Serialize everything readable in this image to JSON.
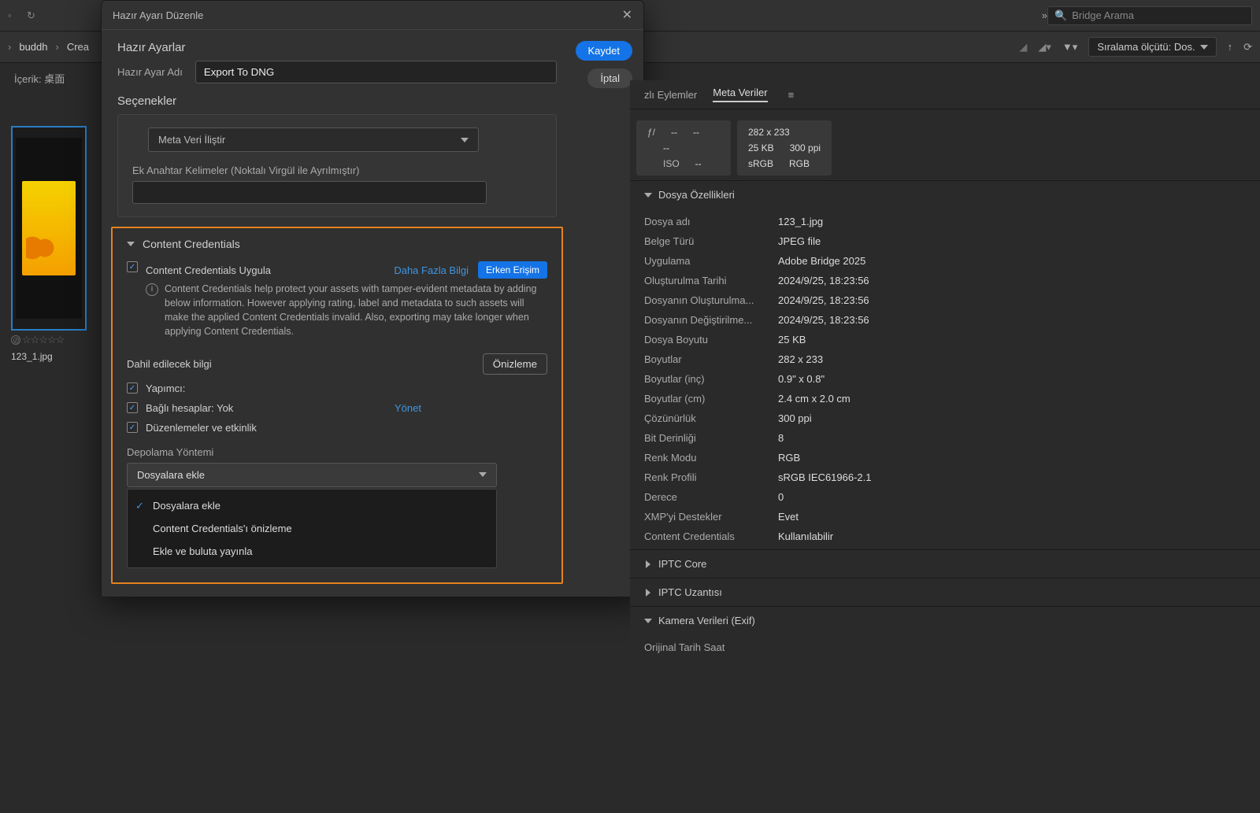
{
  "topBar": {
    "searchPlaceholder": "Bridge Arama",
    "chevrons": "»"
  },
  "breadcrumb": {
    "items": [
      "buddh",
      "Crea"
    ],
    "sortLabel": "Sıralama ölçütü: Dos."
  },
  "contentLabel": "İçerik: 桌面",
  "thumbnail": {
    "filename": "123_1.jpg",
    "stars": "☆☆☆☆☆"
  },
  "dialog": {
    "title": "Hazır Ayarı Düzenle",
    "saveBtn": "Kaydet",
    "cancelBtn": "İptal",
    "presetSection": "Hazır Ayarlar",
    "presetNameLabel": "Hazır Ayar Adı",
    "presetNameValue": "Export To DNG",
    "optionsSection": "Seçenekler",
    "attachMetaLabel": "Meta Veri İliştir",
    "extraKeywordsLabel": "Ek Anahtar Kelimeler (Noktalı Virgül ile Ayrılmıştır)",
    "cc": {
      "header": "Content Credentials",
      "applyLabel": "Content Credentials Uygula",
      "moreInfo": "Daha Fazla Bilgi",
      "earlyAccess": "Erken Erişim",
      "infoText": "Content Credentials help protect your assets with tamper-evident metadata by adding below information. However applying rating, label and metadata to such assets will make the applied Content Credentials invalid. Also, exporting may take longer when applying Content Credentials.",
      "includeLabel": "Dahil edilecek bilgi",
      "previewBtn": "Önizleme",
      "producer": "Yapımcı:",
      "connectedAccounts": "Bağlı hesaplar: Yok",
      "manage": "Yönet",
      "editsActivity": "Düzenlemeler ve etkinlik",
      "storageMethodLabel": "Depolama Yöntemi",
      "storageSelected": "Dosyalara ekle",
      "storageOptions": [
        "Dosyalara ekle",
        "Content Credentials'ı önizleme",
        "Ekle ve buluta yayınla"
      ]
    }
  },
  "rightPanel": {
    "tabs": {
      "quick": "zlı Eylemler",
      "meta": "Meta Veriler"
    },
    "camera": {
      "fLabel": "ƒ/",
      "dash": "--",
      "isoLabel": "ISO",
      "dims": "282 x 233",
      "size": "25 KB",
      "ppi": "300 ppi",
      "profile": "sRGB",
      "mode": "RGB"
    },
    "filePropsHeader": "Dosya Özellikleri",
    "fileProps": [
      {
        "k": "Dosya adı",
        "v": "123_1.jpg"
      },
      {
        "k": "Belge Türü",
        "v": "JPEG file"
      },
      {
        "k": "Uygulama",
        "v": "Adobe Bridge 2025"
      },
      {
        "k": "Oluşturulma Tarihi",
        "v": "2024/9/25, 18:23:56"
      },
      {
        "k": "Dosyanın Oluşturulma...",
        "v": "2024/9/25, 18:23:56"
      },
      {
        "k": "Dosyanın Değiştirilme...",
        "v": "2024/9/25, 18:23:56"
      },
      {
        "k": "Dosya Boyutu",
        "v": "25 KB"
      },
      {
        "k": "Boyutlar",
        "v": "282 x 233"
      },
      {
        "k": "Boyutlar (inç)",
        "v": "0.9\" x 0.8\""
      },
      {
        "k": "Boyutlar (cm)",
        "v": "2.4 cm x 2.0 cm"
      },
      {
        "k": "Çözünürlük",
        "v": "300 ppi"
      },
      {
        "k": "Bit Derinliği",
        "v": "8"
      },
      {
        "k": "Renk Modu",
        "v": "RGB"
      },
      {
        "k": "Renk Profili",
        "v": "sRGB IEC61966-2.1"
      },
      {
        "k": "Derece",
        "v": "0"
      },
      {
        "k": "XMP'yi Destekler",
        "v": "Evet"
      },
      {
        "k": "Content Credentials",
        "v": "Kullanılabilir"
      }
    ],
    "iptcCore": "IPTC Core",
    "iptcExt": "IPTC Uzantısı",
    "cameraDataHeader": "Kamera Verileri (Exif)",
    "origDate": "Orijinal Tarih Saat"
  }
}
